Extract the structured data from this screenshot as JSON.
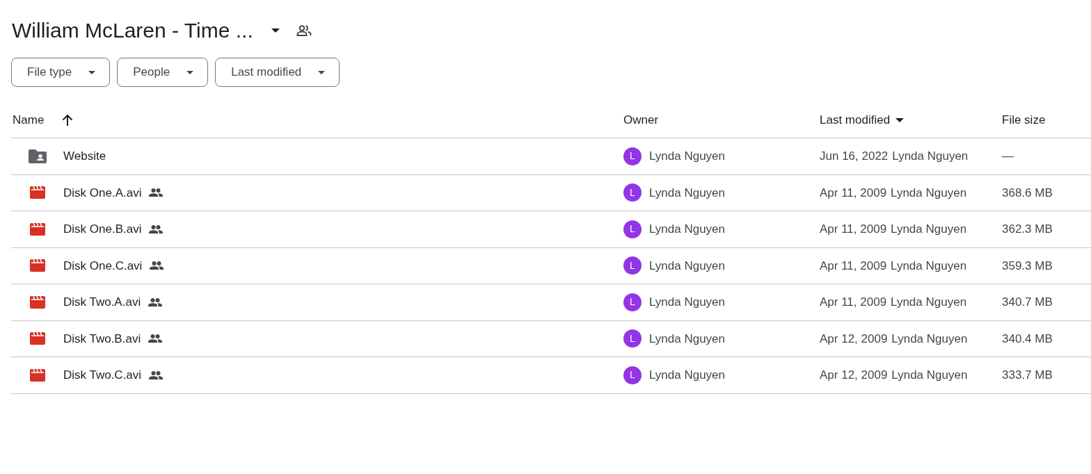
{
  "title": "William McLaren - Time ...",
  "filters": [
    {
      "label": "File type"
    },
    {
      "label": "People"
    },
    {
      "label": "Last modified"
    }
  ],
  "table": {
    "columns": [
      {
        "label": "Name",
        "kind": "sorted"
      },
      {
        "label": "Owner",
        "kind": "plain"
      },
      {
        "label": "Last modified",
        "kind": "menu"
      },
      {
        "label": "File size",
        "kind": "plain"
      }
    ],
    "rows": [
      {
        "kind": "folder",
        "name": "Website",
        "shared": false,
        "avatar": "L",
        "owner": "Lynda Nguyen",
        "date": "Jun 16, 2022",
        "modified_by": "Lynda Nguyen",
        "size": "—"
      },
      {
        "kind": "video",
        "name": "Disk One.A.avi",
        "shared": true,
        "avatar": "L",
        "owner": "Lynda Nguyen",
        "date": "Apr 11, 2009",
        "modified_by": "Lynda Nguyen",
        "size": "368.6 MB"
      },
      {
        "kind": "video",
        "name": "Disk One.B.avi",
        "shared": true,
        "avatar": "L",
        "owner": "Lynda Nguyen",
        "date": "Apr 11, 2009",
        "modified_by": "Lynda Nguyen",
        "size": "362.3 MB"
      },
      {
        "kind": "video",
        "name": "Disk One.C.avi",
        "shared": true,
        "avatar": "L",
        "owner": "Lynda Nguyen",
        "date": "Apr 11, 2009",
        "modified_by": "Lynda Nguyen",
        "size": "359.3 MB"
      },
      {
        "kind": "video",
        "name": "Disk Two.A.avi",
        "shared": true,
        "avatar": "L",
        "owner": "Lynda Nguyen",
        "date": "Apr 11, 2009",
        "modified_by": "Lynda Nguyen",
        "size": "340.7 MB"
      },
      {
        "kind": "video",
        "name": "Disk Two.B.avi",
        "shared": true,
        "avatar": "L",
        "owner": "Lynda Nguyen",
        "date": "Apr 12, 2009",
        "modified_by": "Lynda Nguyen",
        "size": "340.4 MB"
      },
      {
        "kind": "video",
        "name": "Disk Two.C.avi",
        "shared": true,
        "avatar": "L",
        "owner": "Lynda Nguyen",
        "date": "Apr 12, 2009",
        "modified_by": "Lynda Nguyen",
        "size": "333.7 MB"
      }
    ]
  }
}
